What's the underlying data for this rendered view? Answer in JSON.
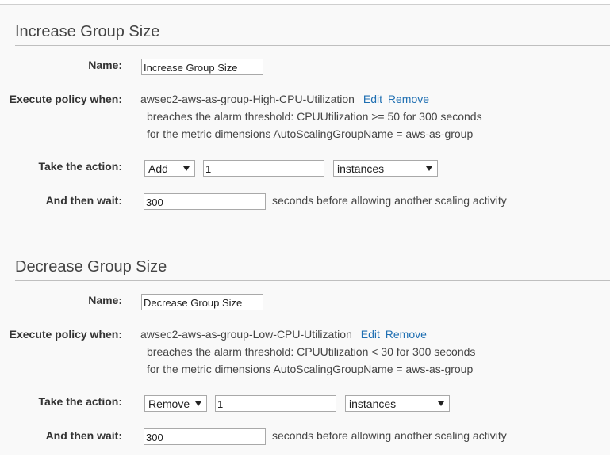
{
  "increase": {
    "title": "Increase Group Size",
    "name_label": "Name:",
    "name_value": "Increase Group Size",
    "execute_label": "Execute policy when:",
    "alarm_name": "awsec2-aws-as-group-High-CPU-Utilization",
    "edit_label": "Edit",
    "remove_label": "Remove",
    "threshold_text": "breaches the alarm threshold: CPUUtilization >= 50 for 300 seconds",
    "dimensions_text": "for the metric dimensions AutoScalingGroupName = aws-as-group",
    "action_label": "Take the action:",
    "action_selected": "Add",
    "action_amount": "1",
    "unit_selected": "instances",
    "wait_label": "And then wait:",
    "wait_value": "300",
    "wait_suffix": "seconds before allowing another scaling activity"
  },
  "decrease": {
    "title": "Decrease Group Size",
    "name_label": "Name:",
    "name_value": "Decrease Group Size",
    "execute_label": "Execute policy when:",
    "alarm_name": "awsec2-aws-as-group-Low-CPU-Utilization",
    "edit_label": "Edit",
    "remove_label": "Remove",
    "threshold_text": "breaches the alarm threshold: CPUUtilization < 30 for 300 seconds",
    "dimensions_text": "for the metric dimensions AutoScalingGroupName = aws-as-group",
    "action_label": "Take the action:",
    "action_selected": "Remove",
    "action_amount": "1",
    "unit_selected": "instances",
    "wait_label": "And then wait:",
    "wait_value": "300",
    "wait_suffix": "seconds before allowing another scaling activity"
  },
  "colors": {
    "link": "#1f6fb2",
    "panel_bg": "#f9f9f9"
  }
}
